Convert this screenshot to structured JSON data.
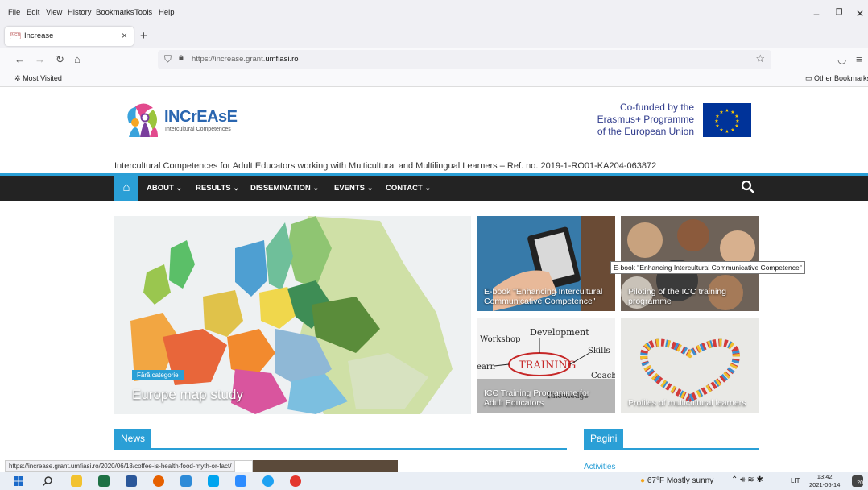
{
  "menu": [
    "File",
    "Edit",
    "View",
    "History",
    "Bookmarks",
    "Tools",
    "Help"
  ],
  "tab": {
    "title": "Increase",
    "favicon_text": "INCR"
  },
  "url": {
    "prefix": "https://increase.grant.",
    "domain": "umfiasi.ro"
  },
  "bookmarks": {
    "most_visited": "Most Visited",
    "other": "Other Bookmarks"
  },
  "site": {
    "logo_title": "INCrEAsE",
    "logo_subtitle": "Intercultural Competences",
    "cofund": [
      "Co-funded by the",
      "Erasmus+ Programme",
      "of the European Union"
    ],
    "tagline": "Intercultural Competences for Adult Educators working with Multicultural and Multilingual Learners – Ref. no. 2019-1-RO01-KA204-063872",
    "nav": [
      "ABOUT",
      "RESULTS",
      "DISSEMINATION",
      "EVENTS",
      "CONTACT"
    ],
    "featured_big": {
      "badge": "Fără categorie",
      "title": "Europe map study"
    },
    "features": [
      "E-book \"Enhancing Intercultural Communicative Competence\"",
      "Piloting of the ICC training programme",
      "ICC Training Programme for Adult Educators",
      "Profiles of multicultural learners"
    ],
    "training_words": [
      "Workshop",
      "Development",
      "Skills",
      "TRAINING",
      "Coach",
      "earn",
      "Knowledge"
    ],
    "tooltip": "E-book \"Enhancing Intercultural Communicative Competence\"",
    "news_heading": "News",
    "pagini_heading": "Pagini",
    "pagini_first": "Activities"
  },
  "status_url": "https://increase.grant.umfiasi.ro/2020/06/18/coffee-is-health-food-myth-or-fact/",
  "taskbar": {
    "weather": "67°F  Mostly sunny",
    "lang": "LIT",
    "time": "13:42",
    "date": "2021-06-14",
    "notif": "20"
  }
}
